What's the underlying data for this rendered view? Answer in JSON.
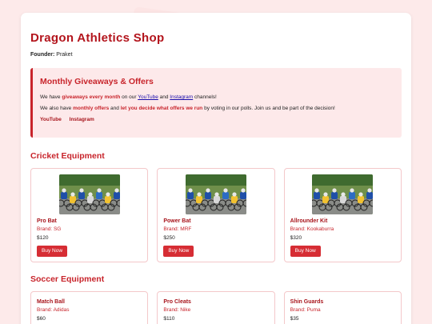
{
  "shop": {
    "title": "Dragon Athletics Shop",
    "founder_label": "Founder:",
    "founder_name": "Praket"
  },
  "offers": {
    "heading": "Monthly Giveaways & Offers",
    "line1": {
      "pre": "We have ",
      "highlight": "giveaways every month",
      "mid": " on our ",
      "link1": "YouTube",
      "and": " and ",
      "link2": "Instagram",
      "post": " channels!"
    },
    "line2": {
      "pre": "We also have ",
      "highlight1": "monthly offers",
      "mid": " and ",
      "highlight2": "let you decide what offers we run",
      "post": " by voting in our polls. Join us and be part of the decision!"
    },
    "links": [
      "YouTube",
      "Instagram"
    ]
  },
  "cricket": {
    "title": "Cricket Equipment",
    "products": [
      {
        "name": "Pro Bat",
        "brand": "Brand: SG",
        "price": "$120",
        "button": "Buy Now"
      },
      {
        "name": "Power Bat",
        "brand": "Brand: MRF",
        "price": "$250",
        "button": "Buy Now"
      },
      {
        "name": "Allrounder Kit",
        "brand": "Brand: Kookaburra",
        "price": "$320",
        "button": "Buy Now"
      }
    ]
  },
  "soccer": {
    "title": "Soccer Equipment",
    "products": [
      {
        "name": "Match Ball",
        "brand": "Brand: Adidas",
        "price": "$60"
      },
      {
        "name": "Pro Cleats",
        "brand": "Brand: Nike",
        "price": "$110"
      },
      {
        "name": "Shin Guards",
        "brand": "Brand: Puma",
        "price": "$35"
      }
    ]
  },
  "colors": {
    "accent": "#c8242b",
    "background": "#fdeaea",
    "button": "#d62d34"
  }
}
